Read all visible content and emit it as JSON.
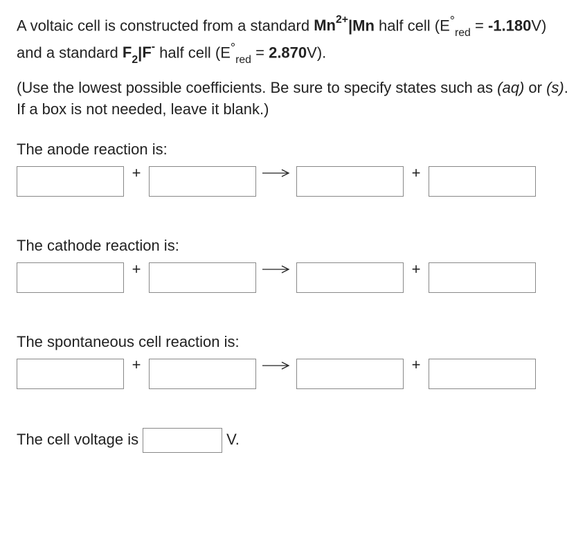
{
  "intro": {
    "prefix": "A voltaic cell is constructed from a standard ",
    "species1_base": "Mn",
    "species1_charge": "2+",
    "divider": "|",
    "species1_other": "Mn",
    "halfcell_text": " half cell (E",
    "deg": "°",
    "red_sub": "red",
    "eq1": " = ",
    "e1_value": "-1.180",
    "volt_unit": "V",
    "mid": ") and a standard ",
    "species2_base": "F",
    "species2_sub": "2",
    "species2_other": "F",
    "species2_charge": "-",
    "eq2": " = ",
    "e2_value": "2.870",
    "close": ")."
  },
  "instructions": {
    "line1": "(Use the lowest possible coefficients. Be sure to specify states such as ",
    "aq": "(aq)",
    "or": " or ",
    "s": "(s)",
    "line2": ". If a box is not needed, leave it blank.)"
  },
  "labels": {
    "anode": "The anode reaction is:",
    "cathode": "The cathode reaction is:",
    "spontaneous": "The spontaneous cell reaction is:",
    "voltage_prefix": "The cell voltage is ",
    "voltage_unit": "V."
  },
  "symbols": {
    "plus": "+",
    "arrow": "→"
  },
  "inputs": {
    "anode": {
      "r1": "",
      "r2": "",
      "p1": "",
      "p2": ""
    },
    "cathode": {
      "r1": "",
      "r2": "",
      "p1": "",
      "p2": ""
    },
    "spontaneous": {
      "r1": "",
      "r2": "",
      "p1": "",
      "p2": ""
    },
    "voltage": ""
  }
}
